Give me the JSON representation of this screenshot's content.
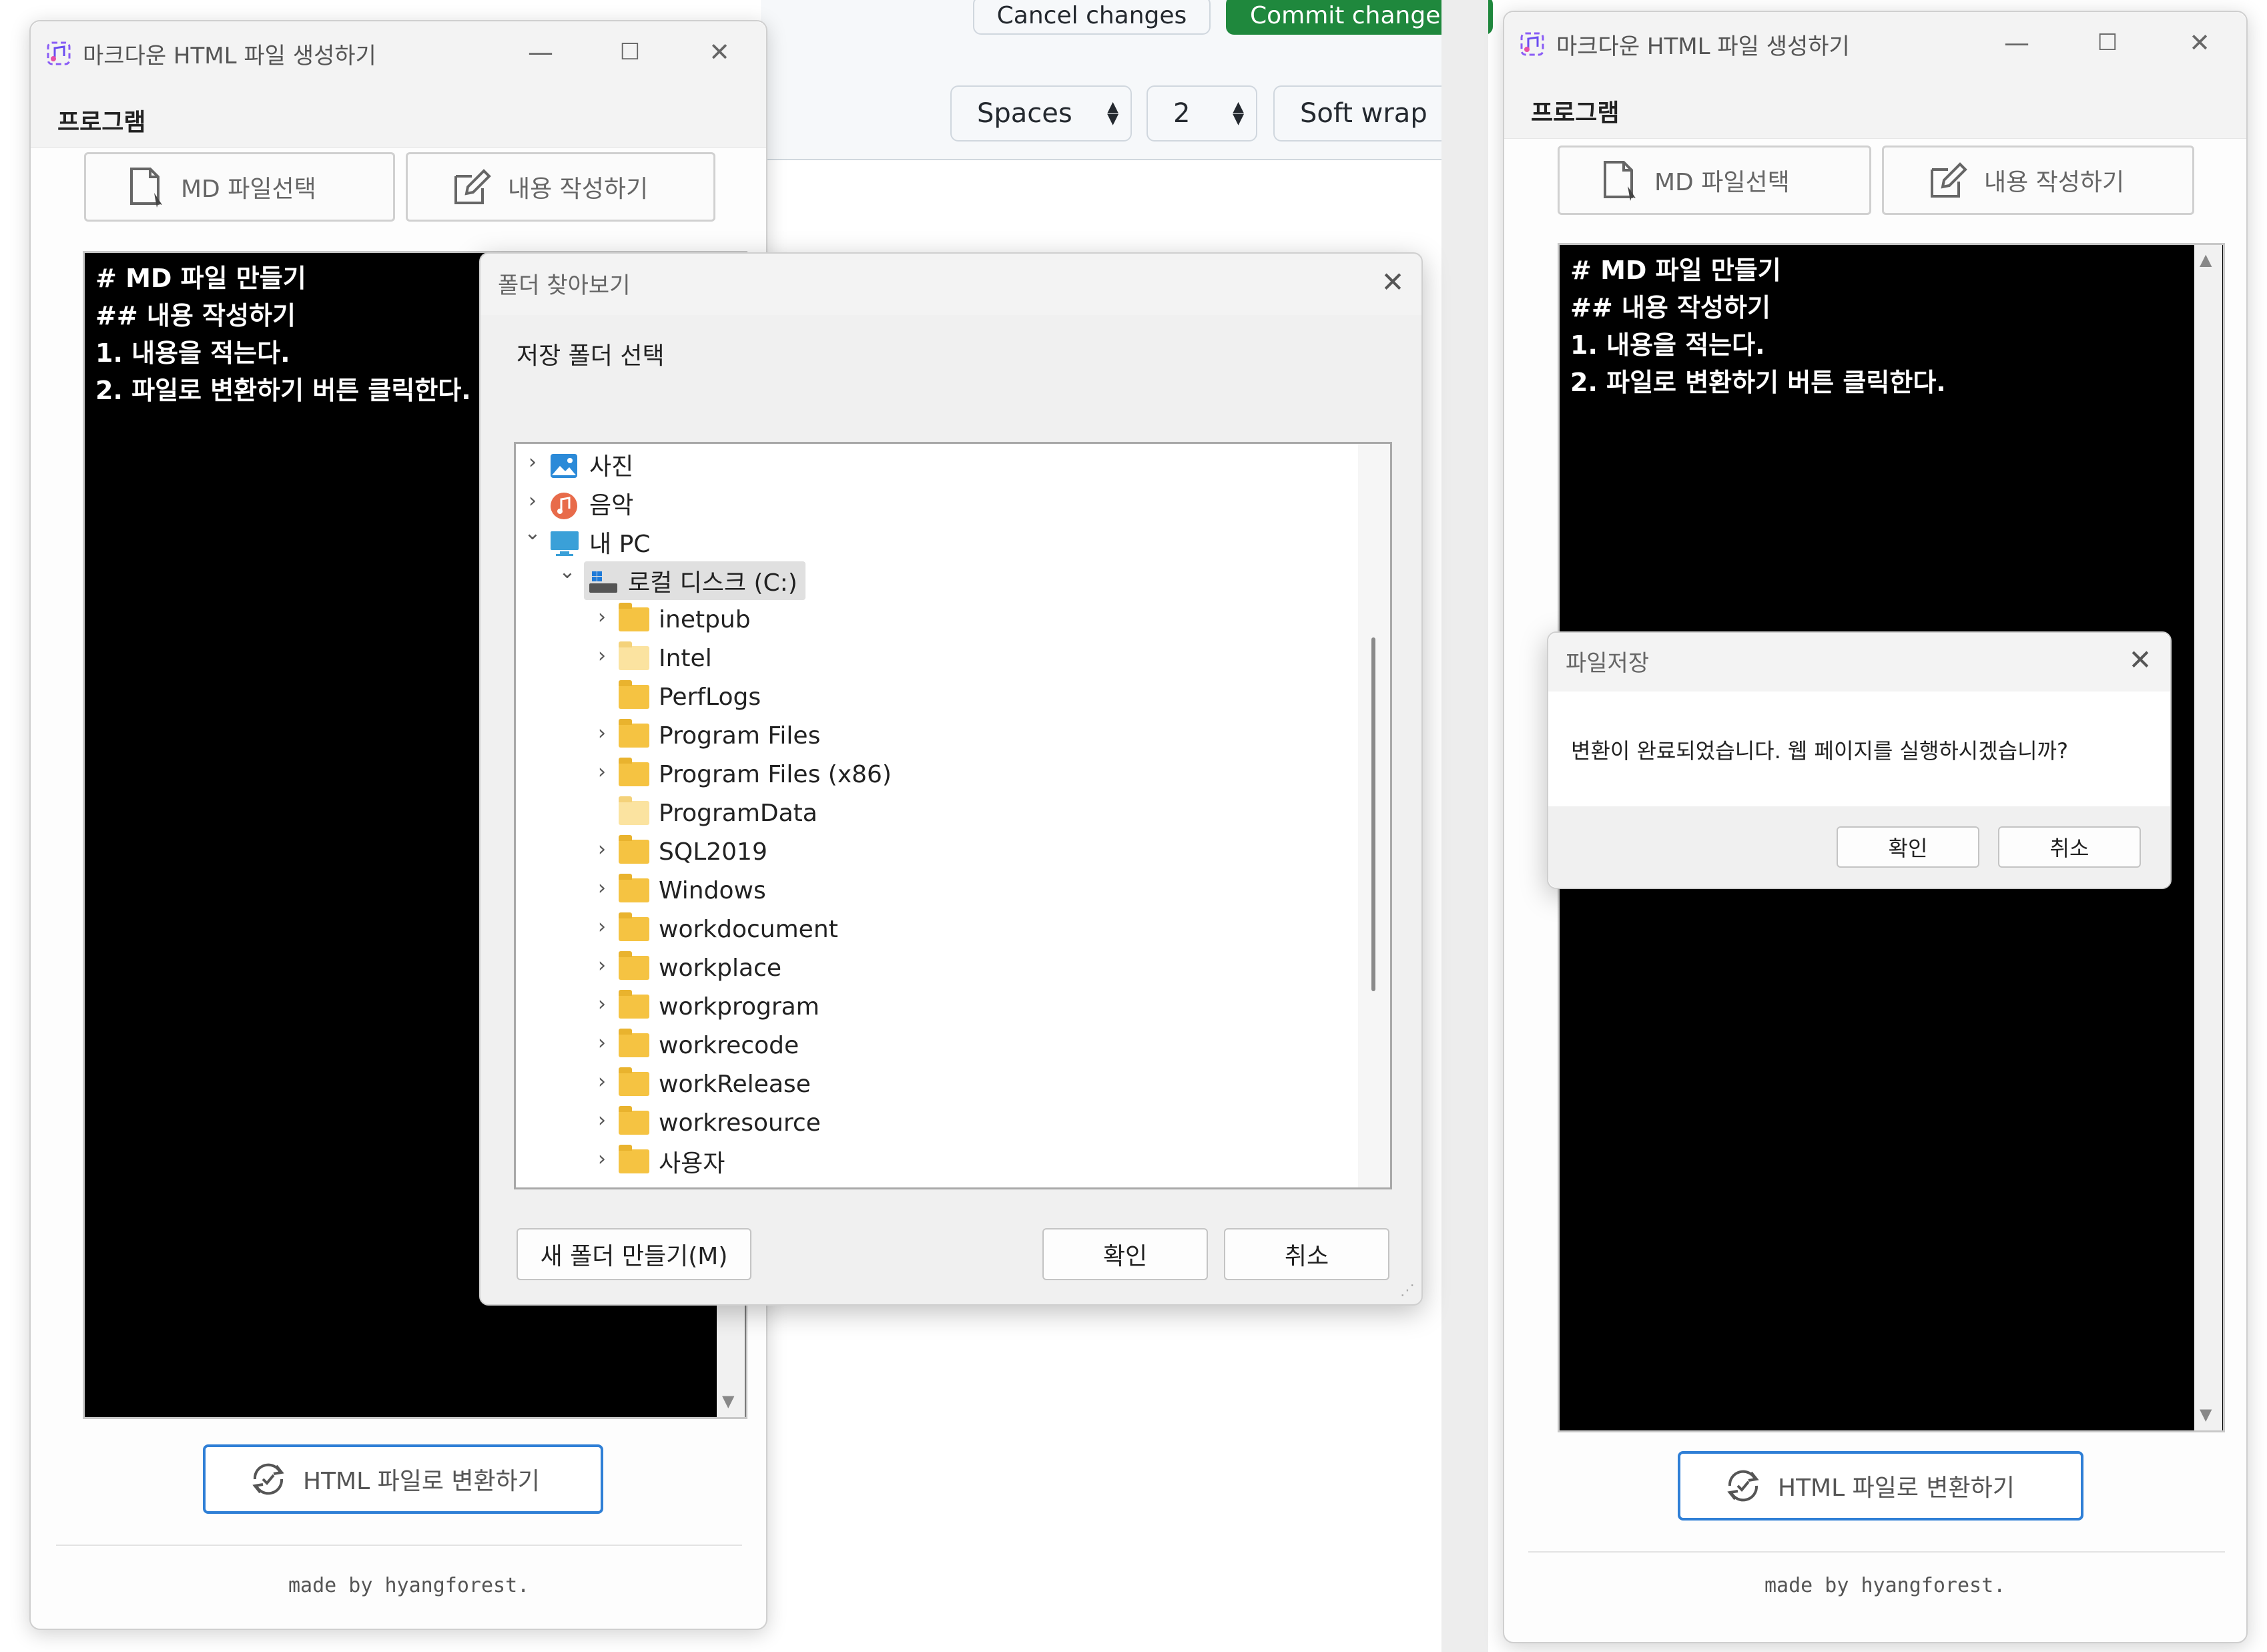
{
  "github": {
    "cancel_label": "Cancel changes",
    "commit_label": "Commit change",
    "indent_mode": "Spaces",
    "indent_size": "2",
    "wrap_mode": "Soft wrap"
  },
  "app_window": {
    "title": "마크다운 HTML 파일 생성하기",
    "menu": "프로그램",
    "md_select_label": "MD 파일선택",
    "write_label": "내용 작성하기",
    "editor_lines": [
      "# MD 파일 만들기",
      "## 내용 작성하기",
      "1. 내용을 적는다.",
      "2. 파일로 변환하기 버튼 클릭한다."
    ],
    "convert_label": "HTML 파일로 변환하기",
    "footer": "made by hyangforest."
  },
  "folder_dialog": {
    "title": "폴더 찾아보기",
    "instruction": "저장 폴더 선택",
    "tree": [
      {
        "label": "사진",
        "icon": "pictures-icon",
        "expander": "collapsed"
      },
      {
        "label": "음악",
        "icon": "music-icon",
        "expander": "collapsed"
      },
      {
        "label": "내 PC",
        "icon": "pc-icon",
        "expander": "expanded"
      },
      {
        "label": "로컬 디스크 (C:)",
        "icon": "drive-icon",
        "expander": "expanded",
        "selected": true
      },
      {
        "label": "inetpub",
        "icon": "folder-icon",
        "expander": "collapsed"
      },
      {
        "label": "Intel",
        "icon": "folder-icon",
        "expander": "collapsed"
      },
      {
        "label": "PerfLogs",
        "icon": "folder-icon",
        "expander": "none"
      },
      {
        "label": "Program Files",
        "icon": "folder-icon",
        "expander": "collapsed"
      },
      {
        "label": "Program Files (x86)",
        "icon": "folder-icon",
        "expander": "collapsed"
      },
      {
        "label": "ProgramData",
        "icon": "folder-icon",
        "expander": "none"
      },
      {
        "label": "SQL2019",
        "icon": "folder-icon",
        "expander": "collapsed"
      },
      {
        "label": "Windows",
        "icon": "folder-icon",
        "expander": "collapsed"
      },
      {
        "label": "workdocument",
        "icon": "folder-icon",
        "expander": "collapsed"
      },
      {
        "label": "workplace",
        "icon": "folder-icon",
        "expander": "collapsed"
      },
      {
        "label": "workprogram",
        "icon": "folder-icon",
        "expander": "collapsed"
      },
      {
        "label": "workrecode",
        "icon": "folder-icon",
        "expander": "collapsed"
      },
      {
        "label": "workRelease",
        "icon": "folder-icon",
        "expander": "collapsed"
      },
      {
        "label": "workresource",
        "icon": "folder-icon",
        "expander": "collapsed"
      },
      {
        "label": "사용자",
        "icon": "folder-icon",
        "expander": "collapsed"
      }
    ],
    "new_folder_label": "새 폴더 만들기(M)",
    "ok_label": "확인",
    "cancel_label": "취소"
  },
  "save_dialog": {
    "title": "파일저장",
    "message": "변환이 완료되었습니다. 웹 페이지를 실행하시겠습니까?",
    "ok_label": "확인",
    "cancel_label": "취소"
  },
  "colors": {
    "commit_green": "#1f883d",
    "convert_border": "#2f7fd6",
    "editor_bg": "#000000",
    "folder_yellow": "#f5c342"
  }
}
